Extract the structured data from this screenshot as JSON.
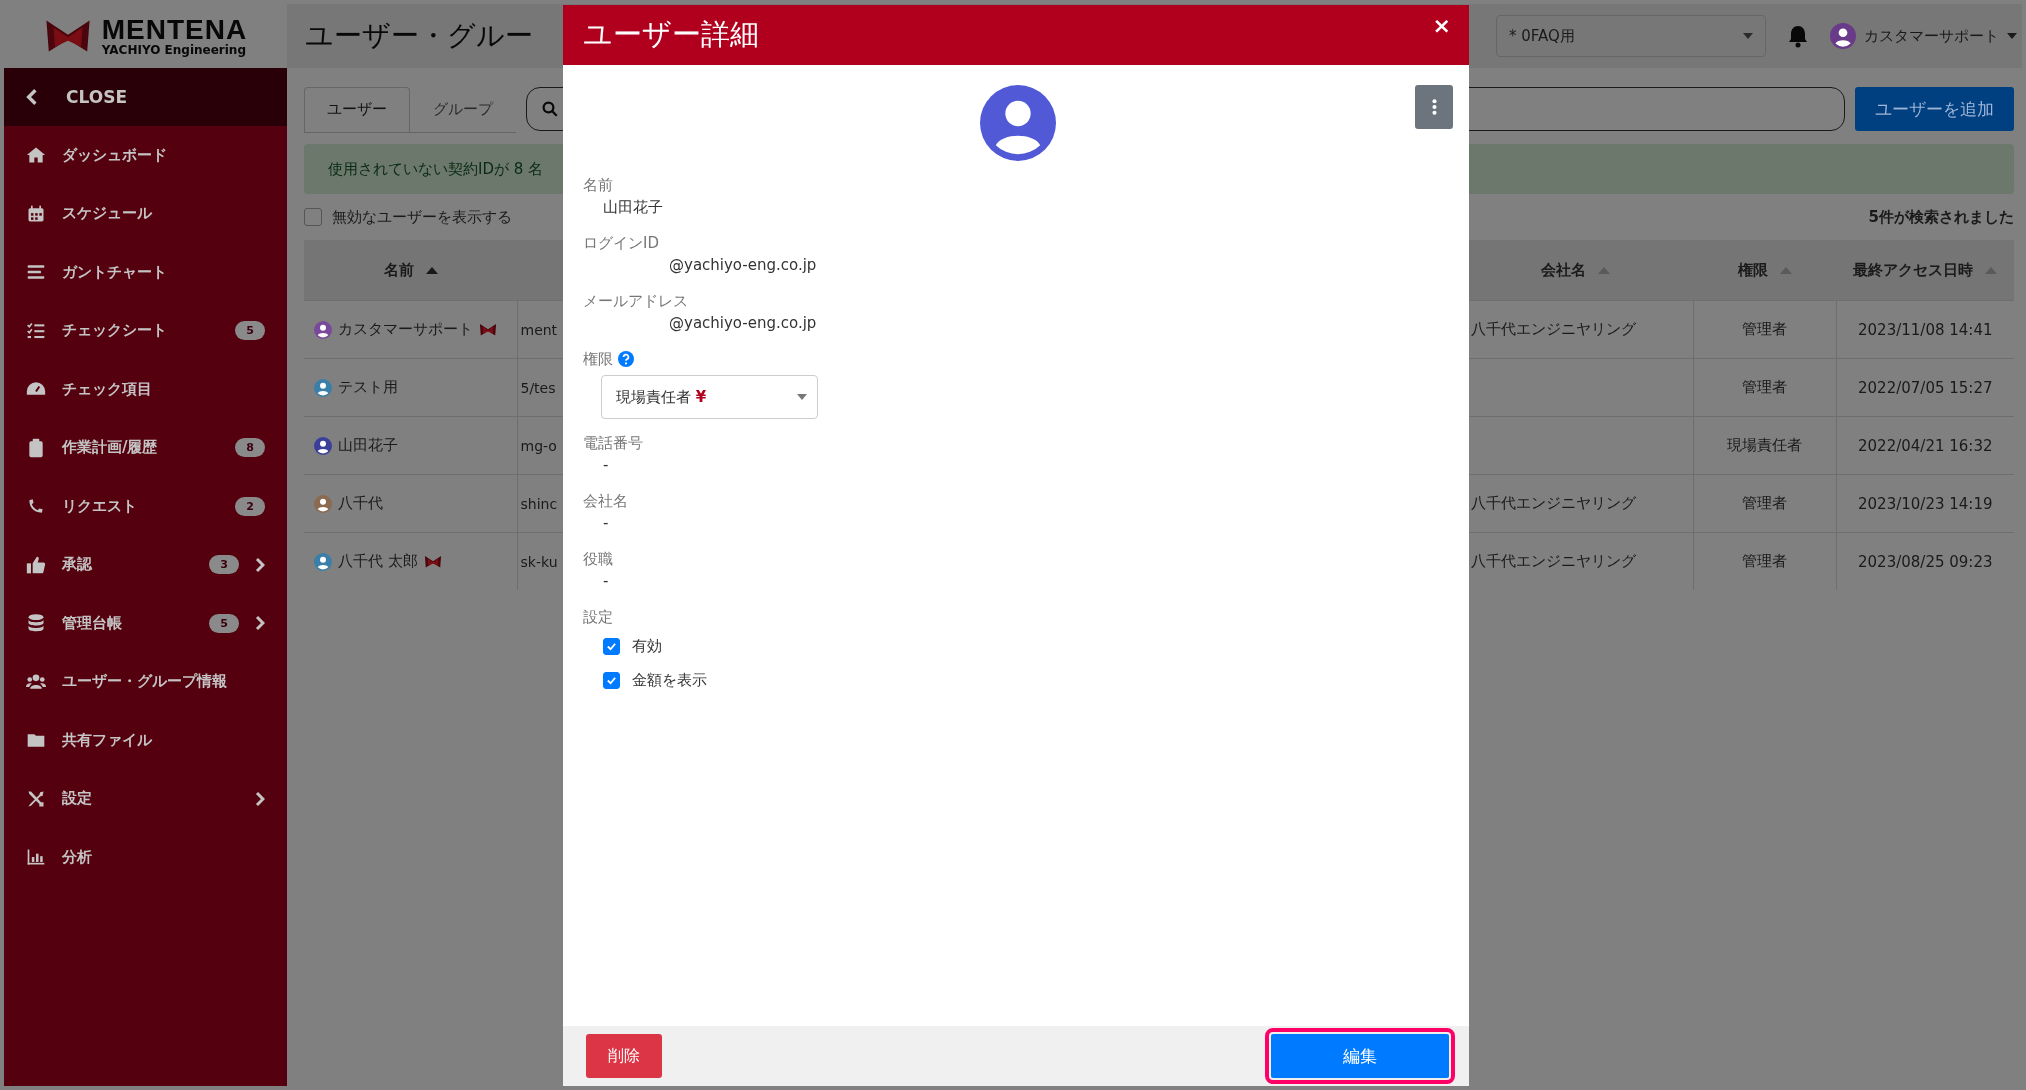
{
  "brand": {
    "name": "MENTENA",
    "tagline": "YACHIYO Engineering"
  },
  "sidebar": {
    "close_label": "CLOSE",
    "items": [
      {
        "label": "ダッシュボード",
        "submenu": false
      },
      {
        "label": "スケジュール",
        "submenu": false
      },
      {
        "label": "ガントチャート",
        "submenu": false
      },
      {
        "label": "チェックシート",
        "badge": "5",
        "submenu": false
      },
      {
        "label": "チェック項目",
        "submenu": false
      },
      {
        "label": "作業計画/履歴",
        "badge": "8",
        "submenu": false
      },
      {
        "label": "リクエスト",
        "badge": "2",
        "submenu": false
      },
      {
        "label": "承認",
        "badge": "3",
        "submenu": true
      },
      {
        "label": "管理台帳",
        "badge": "5",
        "submenu": true
      },
      {
        "label": "ユーザー・グループ情報",
        "submenu": false
      },
      {
        "label": "共有ファイル",
        "submenu": false
      },
      {
        "label": "設定",
        "submenu": true
      },
      {
        "label": "分析",
        "submenu": false
      }
    ]
  },
  "header": {
    "page_title": "ユーザー・グルー",
    "workspace": "* 0FAQ用",
    "user_name": "カスタマーサポート"
  },
  "tabs": [
    {
      "label": "ユーザー",
      "selected": true
    },
    {
      "label": "グループ",
      "selected": false
    }
  ],
  "add_user_button": "ユーザーを追加",
  "alert": "使用されていない契約IDが 8 名",
  "show_disabled": {
    "label": "無効なユーザーを表示する",
    "checked": false
  },
  "result_count": "5件が検索されました",
  "table": {
    "columns": [
      {
        "label": "名前",
        "sorted": true
      },
      {
        "label": "会社名",
        "sorted": false
      },
      {
        "label": "権限",
        "sorted": false
      },
      {
        "label": "最終アクセス日時",
        "sorted": false
      }
    ],
    "rows": [
      {
        "name": "カスタマーサポート",
        "color": "#7a4a9a",
        "mark": true,
        "column_2": "ment",
        "company": "八千代エンジニヤリング",
        "role": "管理者",
        "last_access": "2023/11/08 14:41"
      },
      {
        "name": "テスト用",
        "color": "#3a7fa8",
        "mark": false,
        "column_2": "5/tes",
        "company": "",
        "role": "管理者",
        "last_access": "2022/07/05 15:27"
      },
      {
        "name": "山田花子",
        "color": "#3a3f9a",
        "mark": false,
        "column_2": "mg-o",
        "company": "",
        "role": "現場責任者",
        "last_access": "2022/04/21 16:32"
      },
      {
        "name": "八千代",
        "color": "#8a6a50",
        "mark": false,
        "column_2": "shinc",
        "company": "八千代エンジニヤリング",
        "role": "管理者",
        "last_access": "2023/10/23 14:19"
      },
      {
        "name": "八千代 太郎",
        "color": "#3a7fa8",
        "mark": true,
        "column_2": "sk-ku",
        "company": "八千代エンジニヤリング",
        "role": "管理者",
        "last_access": "2023/08/25 09:23"
      }
    ]
  },
  "modal": {
    "title": "ユーザー詳細",
    "close": "×",
    "fields": [
      {
        "kind": "text",
        "label": "名前",
        "value": "山田花子"
      },
      {
        "kind": "redacted",
        "label": "ログインID",
        "value": "@yachiyo-eng.co.jp"
      },
      {
        "kind": "redacted",
        "label": "メールアドレス",
        "value": "@yachiyo-eng.co.jp"
      },
      {
        "kind": "select",
        "label": "権限",
        "help": true,
        "value": "現場責任者",
        "suffix": "¥"
      },
      {
        "kind": "text",
        "label": "電話番号",
        "value": "-"
      },
      {
        "kind": "text",
        "label": "会社名",
        "value": "-"
      },
      {
        "kind": "text",
        "label": "役職",
        "value": "-"
      },
      {
        "kind": "checks",
        "label": "設定",
        "options": [
          {
            "label": "有効",
            "checked": true
          },
          {
            "label": "金額を表示",
            "checked": true
          }
        ]
      }
    ],
    "delete_button": "削除",
    "edit_button": {
      "label": "編集",
      "highlighted": true
    }
  }
}
